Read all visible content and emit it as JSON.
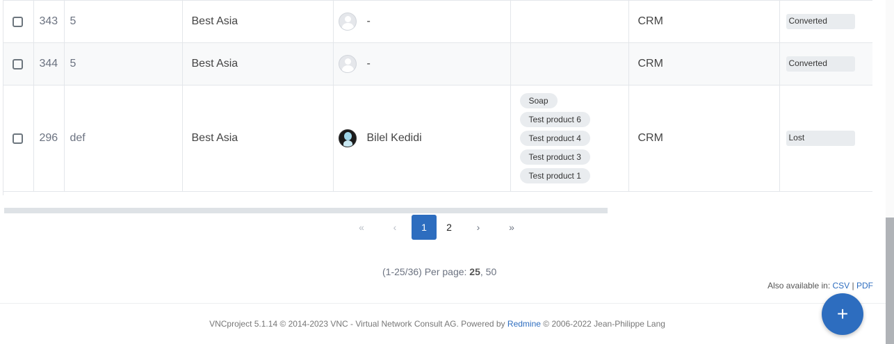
{
  "rows": [
    {
      "id": "343",
      "subject": "5",
      "customer": "Best Asia",
      "assignee": "-",
      "products": [],
      "project": "CRM",
      "status": "Converted"
    },
    {
      "id": "344",
      "subject": "5",
      "customer": "Best Asia",
      "assignee": "-",
      "products": [],
      "project": "CRM",
      "status": "Converted"
    },
    {
      "id": "296",
      "subject": "def",
      "customer": "Best Asia",
      "assignee": "Bilel Kedidi",
      "products": [
        "Soap",
        "Test product 6",
        "Test product 4",
        "Test product 3",
        "Test product 1"
      ],
      "project": "CRM",
      "status": "Lost"
    }
  ],
  "pagination": {
    "first": "«",
    "prev": "‹",
    "pages": [
      "1",
      "2"
    ],
    "current": "1",
    "next": "›",
    "last": "»",
    "range": "(1-25/36) Per page:",
    "per_page_current": "25",
    "per_page_sep": ", ",
    "per_page_other": "50"
  },
  "export": {
    "label": "Also available in:",
    "csv": "CSV",
    "sep": "|",
    "pdf": "PDF"
  },
  "footer": {
    "prefix": "VNCproject 5.1.14 © 2014-2023 VNC - Virtual Network Consult AG. Powered by",
    "link": "Redmine",
    "suffix": "© 2006-2022 Jean-Philippe Lang"
  },
  "fab": {
    "label": "+"
  },
  "colors": {
    "accent": "#2d6dbf",
    "badge_bg": "#e9ecef"
  }
}
